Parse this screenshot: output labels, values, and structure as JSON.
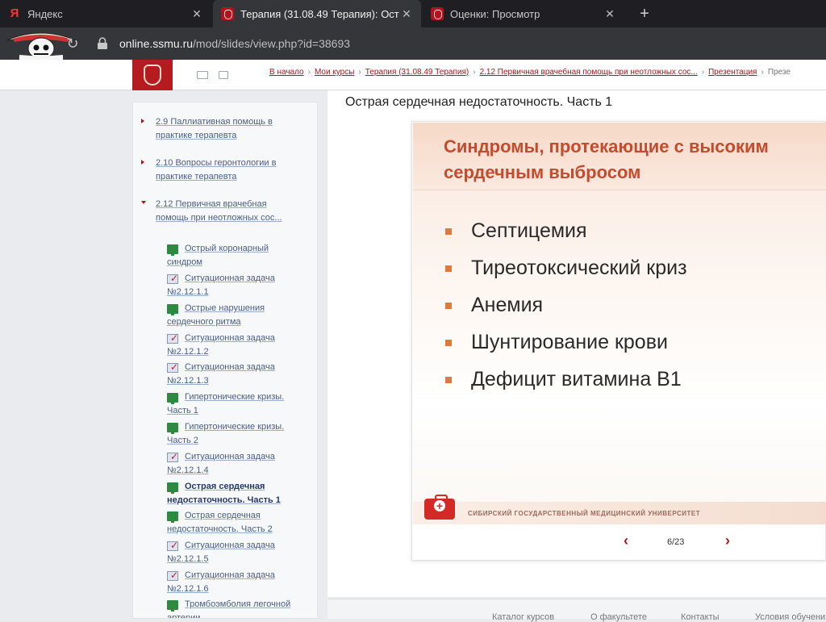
{
  "browser": {
    "tabs": [
      {
        "title": "Яндекс",
        "favicon": "yandex-icon",
        "active": false
      },
      {
        "title": "Терапия (31.08.49 Терапия): Ост",
        "favicon": "university-crest-icon",
        "active": true
      },
      {
        "title": "Оценки: Просмотр",
        "favicon": "university-crest-icon",
        "active": false
      }
    ],
    "new_tab": "+",
    "url_host": "online.ssmu.ru",
    "url_path": "/mod/slides/view.php?id=38693"
  },
  "breadcrumbs": [
    "В начало",
    "Мои курсы",
    "Терапия (31.08.49 Терапия)",
    "2.12 Первичная врачебная помощь при неотложных сос...",
    "Презентация",
    "Презе"
  ],
  "sidebar": {
    "sections": [
      {
        "label": "2.9 Паллиативная помощь в практике терапевта",
        "expanded": false
      },
      {
        "label": "2.10 Вопросы геронтологии в практике терапевта",
        "expanded": false
      },
      {
        "label": "2.12 Первичная врачебная помощь при неотложных сос...",
        "expanded": true
      }
    ],
    "items": [
      {
        "label": "Острый коронарный синдром",
        "type": "presentation"
      },
      {
        "label": "Ситуационная задача №2.12.1.1",
        "type": "quiz"
      },
      {
        "label": "Острые нарушения сердечного ритма",
        "type": "presentation"
      },
      {
        "label": "Ситуационная задача №2.12.1.2",
        "type": "quiz"
      },
      {
        "label": "Ситуационная задача №2.12.1.3",
        "type": "quiz"
      },
      {
        "label": "Гипертонические кризы. Часть 1",
        "type": "presentation"
      },
      {
        "label": "Гипертонические кризы. Часть 2",
        "type": "presentation"
      },
      {
        "label": "Ситуационная задача №2.12.1.4",
        "type": "quiz"
      },
      {
        "label": "Острая сердечная недостаточность. Часть 1",
        "type": "presentation",
        "current": true
      },
      {
        "label": "Острая сердечная недостаточность. Часть 2",
        "type": "presentation"
      },
      {
        "label": "Ситуационная задача №2.12.1.5",
        "type": "quiz"
      },
      {
        "label": "Ситуационная задача №2.12.1.6",
        "type": "quiz"
      },
      {
        "label": "Тромбоэмболия легочной артерии",
        "type": "presentation"
      }
    ]
  },
  "main": {
    "title": "Острая сердечная недостаточность. Часть 1",
    "slide": {
      "heading": "Синдромы, протекающие с высоким сердечным выбросом",
      "bullets": [
        "Септицемия",
        "Тиреотоксический криз",
        "Анемия",
        "Шунтирование крови",
        "Дефицит витамина B1"
      ],
      "footer": "Сибирский государственный медицинский университет"
    },
    "pager": {
      "prev": "‹",
      "next": "›",
      "counter": "6/23",
      "current_page": 6,
      "total_pages": 23
    }
  },
  "footer_links": [
    "Каталог курсов",
    "О факультете",
    "Контакты",
    "Условия обучени"
  ],
  "colors": {
    "brand_red": "#b51b1f",
    "slide_title": "#c44c2e",
    "bullet_square": "#e07a3c",
    "link_blue": "#4a5f86"
  }
}
